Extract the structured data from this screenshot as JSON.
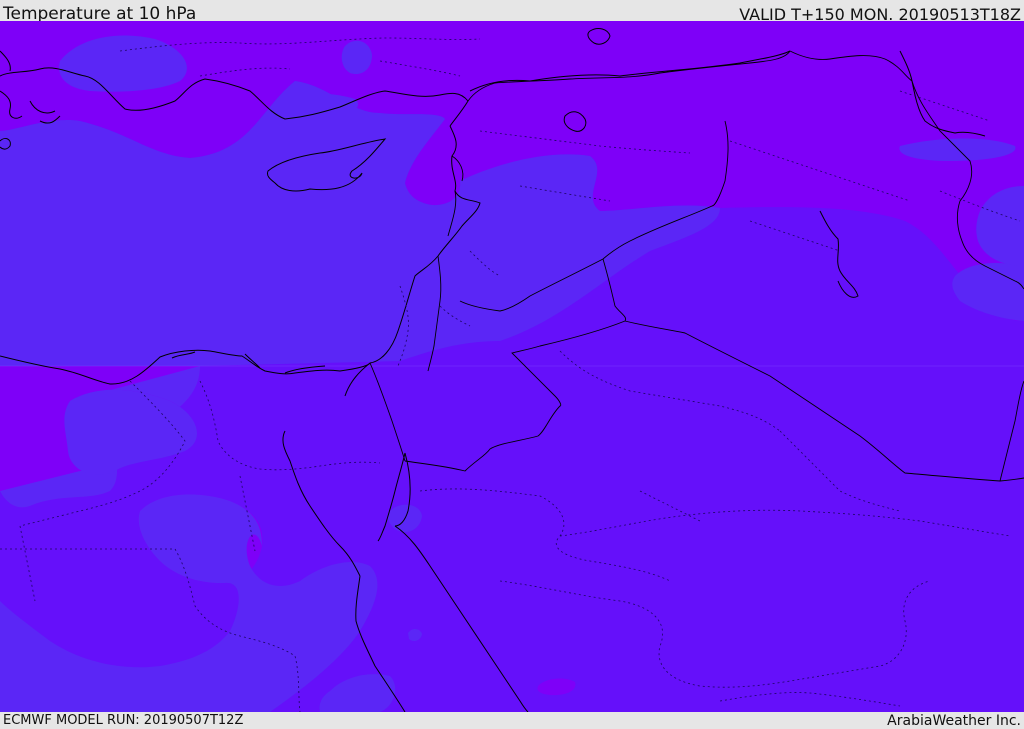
{
  "header": {
    "title": "Temperature at 10 hPa",
    "valid": "VALID T+150 MON. 20190513T18Z"
  },
  "footer": {
    "model_run": "ECMWF MODEL RUN: 20190507T12Z",
    "credit": "ArabiaWeather Inc."
  },
  "map": {
    "colors": {
      "base": "#6510fa",
      "warm": "#7e00f8",
      "cool": "#5b26f6",
      "coastline": "#000000",
      "border": "#000000",
      "province": "#1c0560"
    }
  }
}
